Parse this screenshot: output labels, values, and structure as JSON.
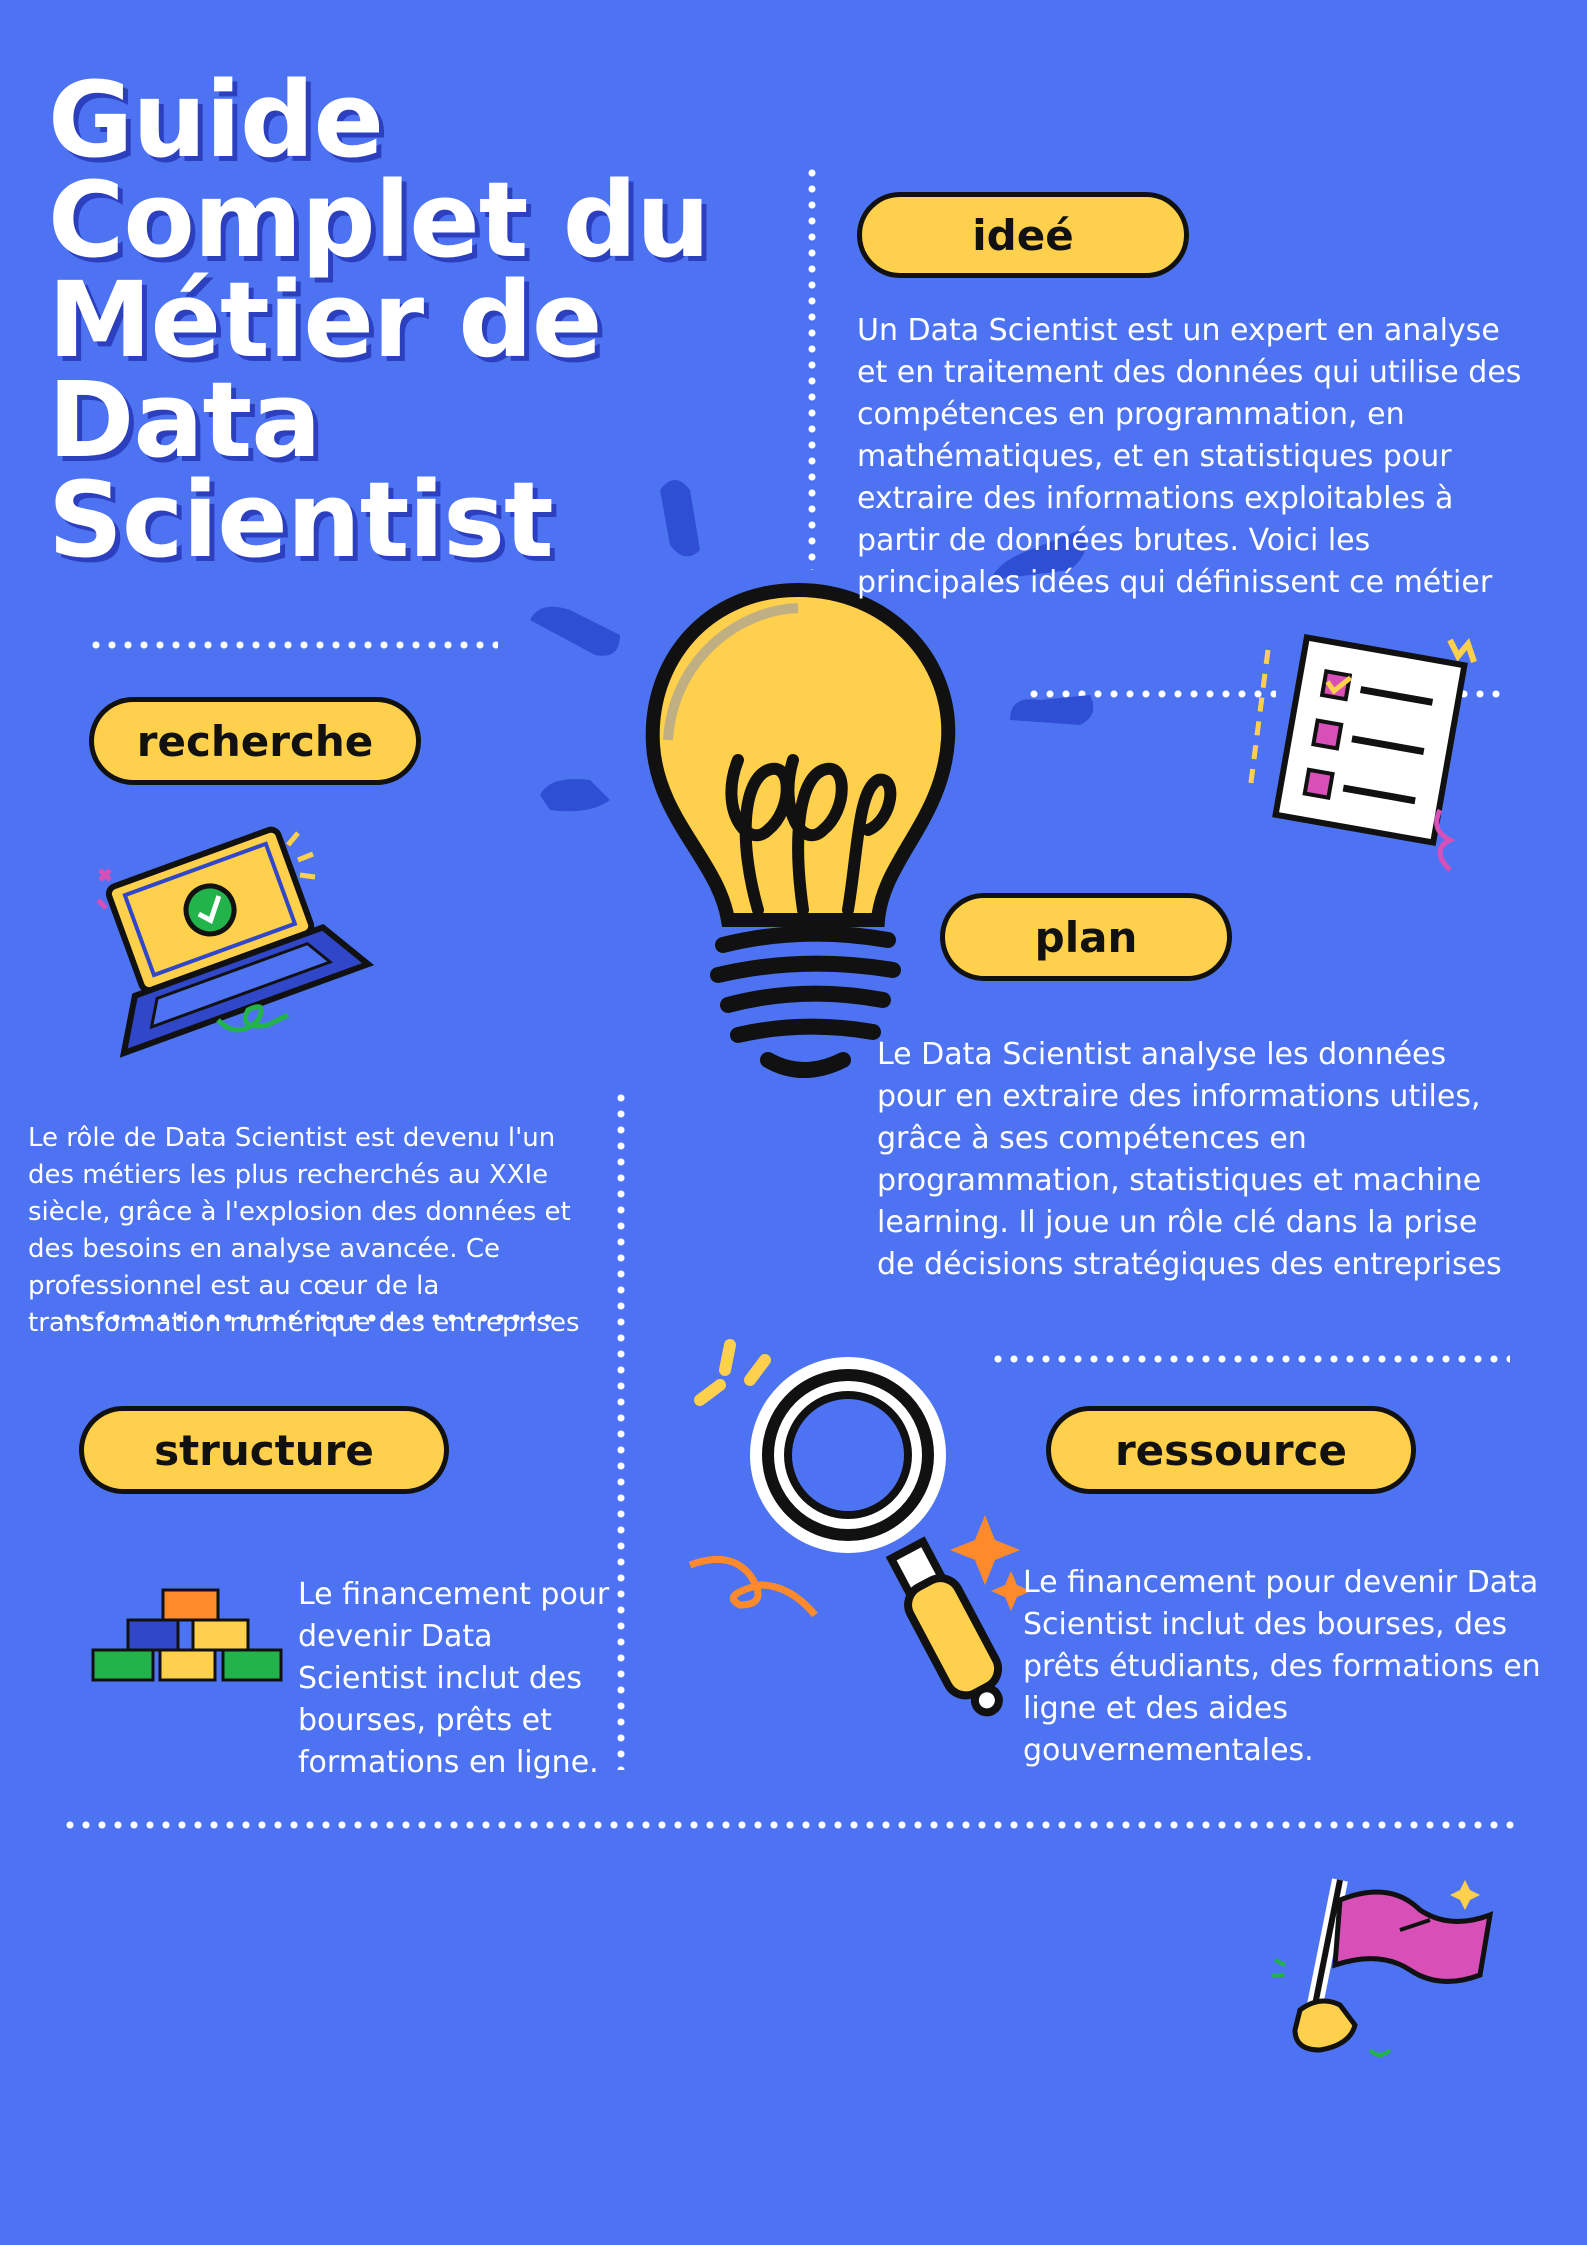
{
  "title": {
    "line1": "Guide",
    "line2": "Complet du",
    "line3": "Métier de",
    "line4": "Data",
    "line5": "Scientist"
  },
  "sections": {
    "idee": {
      "label": "ideé",
      "text": "Un Data Scientist est un expert en analyse et en traitement des données qui utilise des compétences en programmation, en mathématiques, et en statistiques pour extraire des informations exploitables à partir de données brutes. Voici les principales idées qui définissent ce métier"
    },
    "recherche": {
      "label": "recherche",
      "text": "Le rôle de Data Scientist est devenu l'un des métiers les plus recherchés au XXIe siècle, grâce à l'explosion des données et des besoins en analyse avancée. Ce professionnel est au cœur de la transformation numérique des entreprises"
    },
    "plan": {
      "label": "plan",
      "text": "Le Data Scientist analyse les données pour en extraire des informations utiles, grâce à ses compétences en programmation, statistiques et machine learning. Il joue un rôle clé dans la prise de décisions stratégiques des entreprises"
    },
    "structure": {
      "label": "structure",
      "text": "Le financement pour devenir Data Scientist inclut des bourses, prêts et formations en ligne."
    },
    "ressource": {
      "label": "ressource",
      "text": "Le financement pour devenir Data Scientist inclut des bourses, des prêts étudiants, des formations en ligne et des aides gouvernementales."
    }
  },
  "icons": [
    "lightbulb-icon",
    "checklist-icon",
    "laptop-icon",
    "magnifier-icon",
    "blocks-icon",
    "flag-icon"
  ],
  "colors": {
    "background": "#4e73f2",
    "pill": "#ffd04b",
    "title_shadow": "#2b3fbf",
    "accent_pink": "#d94fb8",
    "accent_orange": "#ff8a2b"
  }
}
